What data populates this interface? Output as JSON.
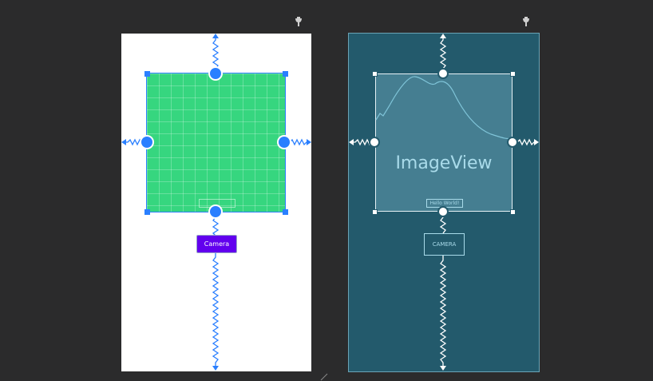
{
  "canvas": {
    "design": {
      "button_label": "Camera",
      "tool_icon": "wrench-icon"
    },
    "blueprint": {
      "imageview_label": "ImageView",
      "textview_label": "Hello World!",
      "button_label": "CAMERA",
      "tool_icon": "wrench-icon"
    }
  },
  "colors": {
    "editor_bg": "#2b2b2c",
    "blueprint_bg": "#235a6c",
    "image_fill": "#36d67f",
    "button_fill": "#6200ee",
    "constraint_blue": "#2a7fff"
  }
}
